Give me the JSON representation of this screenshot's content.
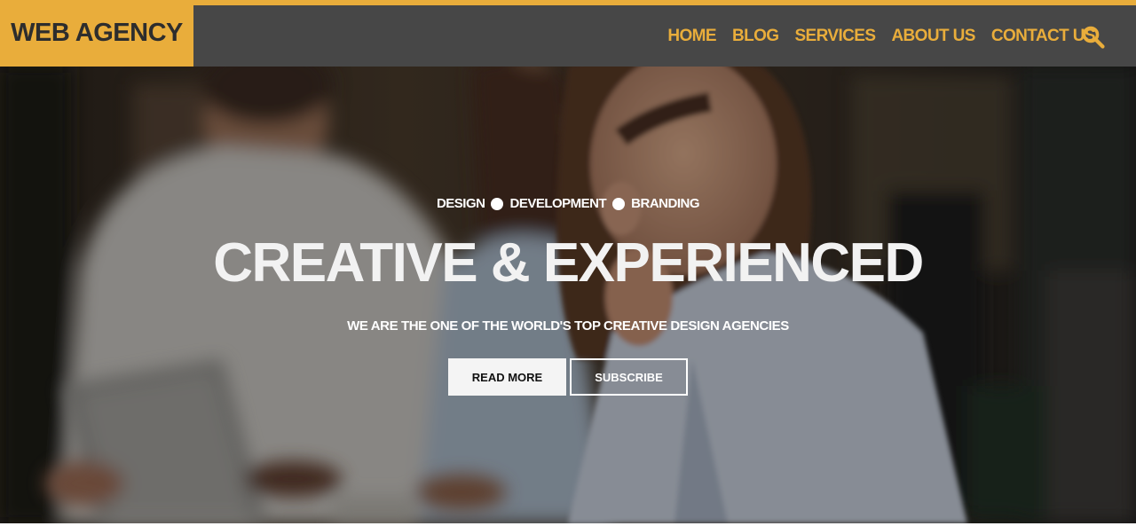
{
  "brand": {
    "name": "WEB AGENCY",
    "accent": "#e9ad3b",
    "header_bg": "#474747"
  },
  "nav": {
    "items": [
      {
        "label": "HOME"
      },
      {
        "label": "BLOG"
      },
      {
        "label": "SERVICES"
      },
      {
        "label": "ABOUT US"
      },
      {
        "label": "CONTACT US"
      }
    ],
    "search_icon": "search-icon"
  },
  "hero": {
    "tags": [
      "DESIGN",
      "DEVELOPMENT",
      "BRANDING"
    ],
    "headline": "CREATIVE & EXPERIENCED",
    "subheadline": "WE ARE THE ONE OF THE WORLD'S TOP CREATIVE DESIGN AGENCIES",
    "primary_button": "READ MORE",
    "secondary_button": "SUBSCRIBE"
  }
}
